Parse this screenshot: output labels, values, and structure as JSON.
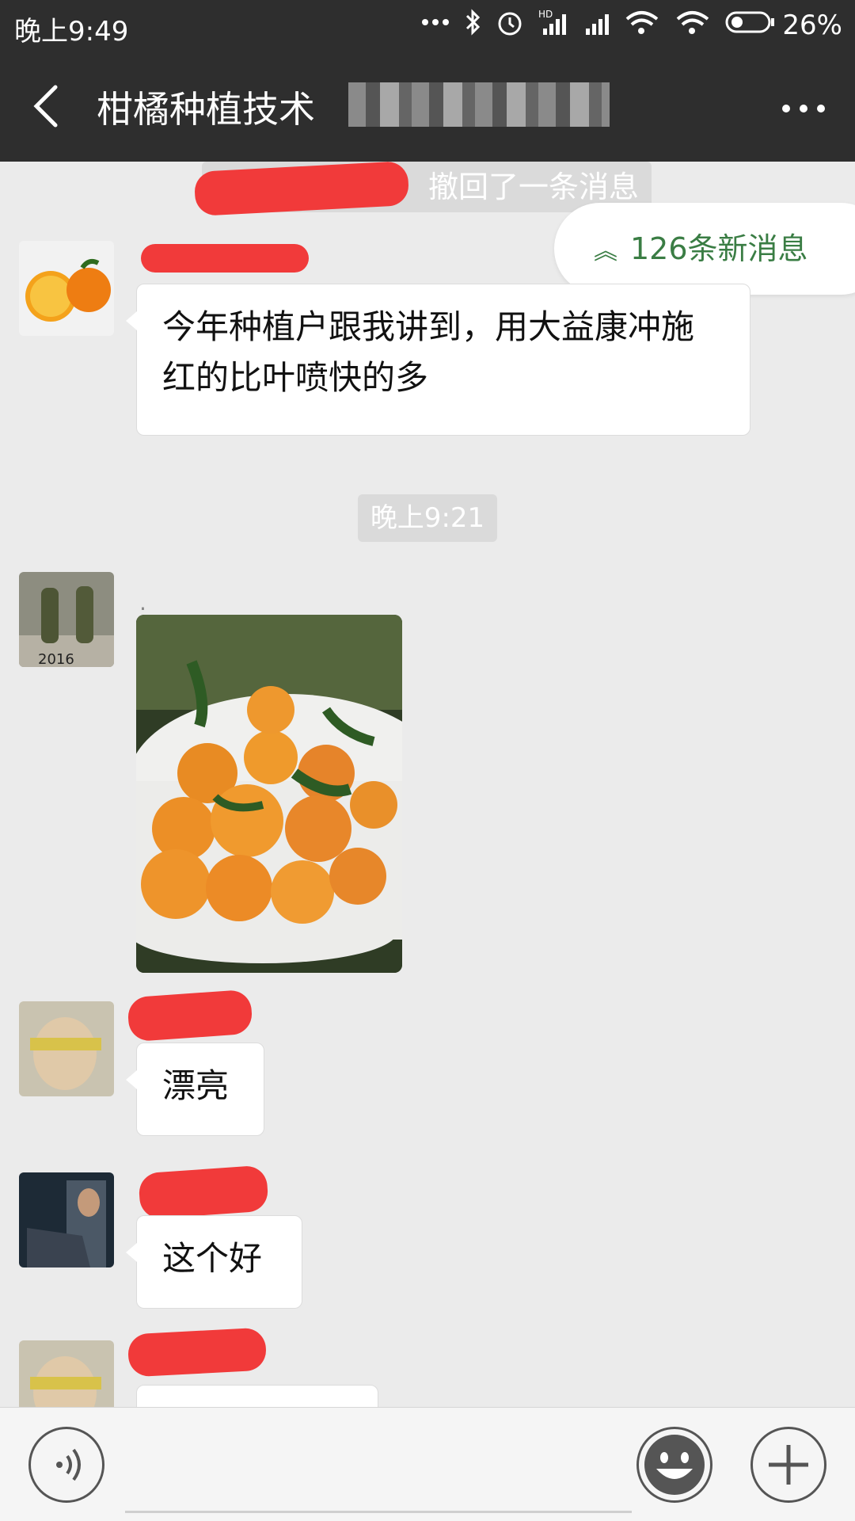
{
  "status_bar": {
    "time": "晚上9:49",
    "battery_pct": "26%",
    "icons": [
      "more-dots-icon",
      "bluetooth-icon",
      "alarm-icon",
      "hd-signal-icon",
      "signal-icon",
      "wifi-link-icon",
      "wifi-icon",
      "battery-icon"
    ]
  },
  "header": {
    "title": "柑橘种植技术"
  },
  "chat": {
    "recall_text": "撤回了一条消息",
    "new_messages": "126条新消息",
    "time_chip": "晚上9:21",
    "messages": [
      {
        "text": "今年种植户跟我讲到，用大益康冲施红的比叶喷快的多"
      },
      {
        "sender_mark": "."
      },
      {
        "text": "漂亮"
      },
      {
        "text": "这个好"
      }
    ]
  },
  "colors": {
    "bar_bg": "#2e2e2e",
    "chat_bg": "#ebebeb",
    "accent_green": "#3a7d44",
    "redaction": "#f13a3a"
  }
}
